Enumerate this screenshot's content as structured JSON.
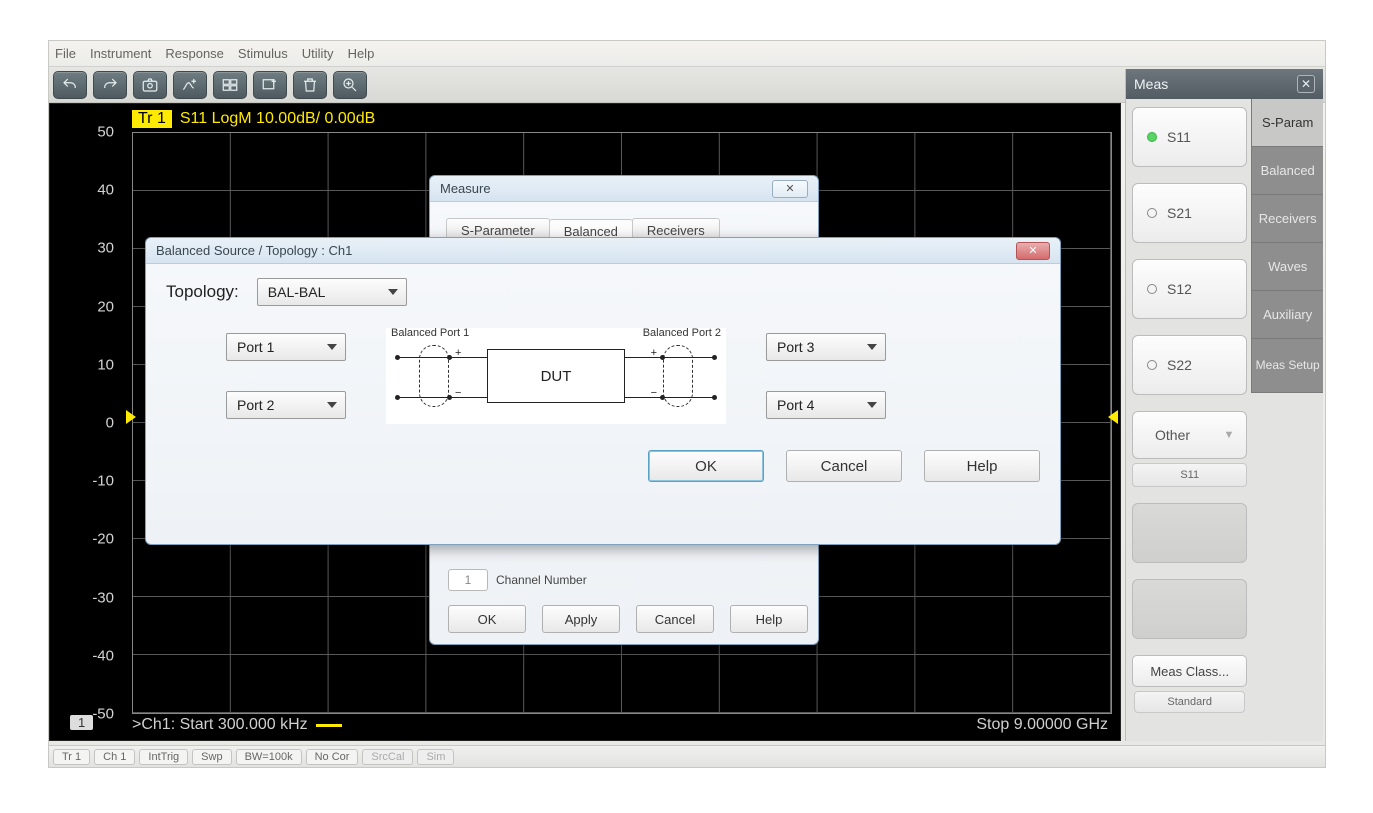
{
  "menu": {
    "file": "File",
    "instrument": "Instrument",
    "response": "Response",
    "stimulus": "Stimulus",
    "utility": "Utility",
    "help": "Help"
  },
  "trace": {
    "chip": "Tr 1",
    "text": "S11 LogM 10.00dB/ 0.00dB"
  },
  "yaxis": [
    "50",
    "40",
    "30",
    "20",
    "10",
    "0",
    "-10",
    "-20",
    "-30",
    "-40",
    "-50"
  ],
  "ch_badge": "1",
  "ch_status": ">Ch1:  Start  300.000 kHz",
  "stop_label": "Stop  9.00000 GHz",
  "status": {
    "tr": "Tr 1",
    "ch": "Ch 1",
    "trig": "IntTrig",
    "swp": "Swp",
    "bw": "BW=100k",
    "cor": "No Cor",
    "srccal": "SrcCal",
    "sim": "Sim"
  },
  "right_panel": {
    "header": "Meas",
    "items": [
      {
        "label": "S11",
        "on": true
      },
      {
        "label": "S21",
        "on": false
      },
      {
        "label": "S12",
        "on": false
      },
      {
        "label": "S22",
        "on": false
      }
    ],
    "other": "Other",
    "other_sub": "S11",
    "meas_class": "Meas Class...",
    "meas_class_sub": "Standard",
    "side_tabs": [
      "S-Param",
      "Balanced",
      "Receivers",
      "Waves",
      "Auxiliary",
      "Meas\nSetup"
    ]
  },
  "dlg_measure": {
    "title": "Measure",
    "tabs": [
      "S-Parameter",
      "Balanced",
      "Receivers"
    ],
    "channel_number_label": "Channel Number",
    "channel_number_value": "1",
    "buttons": {
      "ok": "OK",
      "apply": "Apply",
      "cancel": "Cancel",
      "help": "Help"
    }
  },
  "dlg_topology": {
    "title": "Balanced Source / Topology : Ch1",
    "topology_label": "Topology:",
    "topology_value": "BAL-BAL",
    "ports_left": [
      "Port 1",
      "Port 2"
    ],
    "ports_right": [
      "Port 3",
      "Port 4"
    ],
    "diagram": {
      "left_label": "Balanced Port 1",
      "right_label": "Balanced Port 2",
      "dut": "DUT"
    },
    "buttons": {
      "ok": "OK",
      "cancel": "Cancel",
      "help": "Help"
    }
  }
}
